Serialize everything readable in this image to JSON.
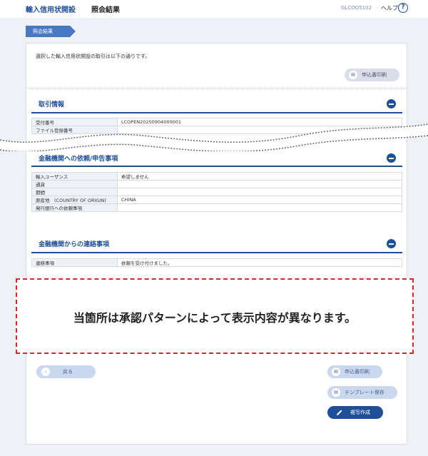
{
  "header": {
    "title": "輸入信用状開設",
    "subtitle": "照会結果",
    "screen_code": "GLCOO5102",
    "help_label": "ヘルプ",
    "help_icon": "?"
  },
  "breadcrumb": {
    "current": "照会結果"
  },
  "intro_text": "選択した輸入信用状開設の取引は以下の通りです。",
  "buttons": {
    "print_top": "申込書印刷",
    "back": "戻る",
    "print_bottom": "申込書印刷",
    "template_save": "テンプレート保存",
    "copy_create": "複写作成"
  },
  "sections": {
    "transaction": {
      "title": "取引情報",
      "rows": [
        {
          "key": "受付番号",
          "value": "LCOPEN20250904000001"
        },
        {
          "key": "ファイル登録番号",
          "value": ""
        }
      ]
    },
    "request": {
      "title": "金融機関への依頼/申告事項",
      "rows": [
        {
          "key": "輸入ユーザンス",
          "value": "希望しません"
        },
        {
          "key": "通貨",
          "value": ""
        },
        {
          "key": "期間",
          "value": ""
        },
        {
          "key": "原産地　(COUNTRY OF ORIGIN)",
          "value": "CHINA"
        },
        {
          "key": "発行銀行への依頼事項",
          "value": ""
        }
      ]
    },
    "contact": {
      "title": "金融機関からの連絡事項",
      "rows": [
        {
          "key": "連絡事項",
          "value": "依頼を受け付けました。"
        }
      ]
    }
  },
  "notice": "当箇所は承認パターンによって表示内容が異なります。",
  "colors": {
    "accent": "#1f4f99",
    "notice_border": "#e02424"
  }
}
